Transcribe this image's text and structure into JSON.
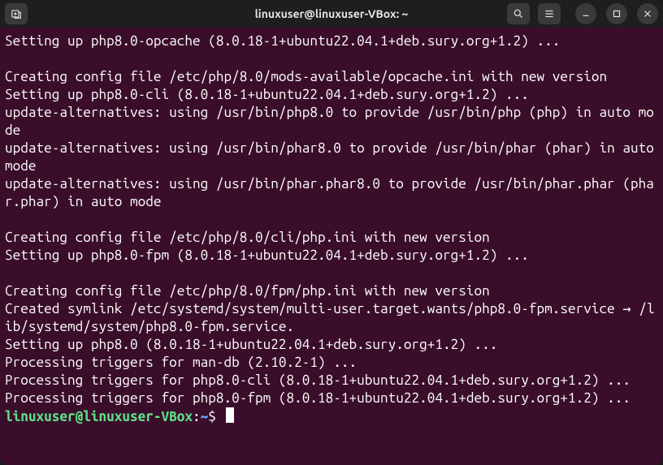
{
  "titlebar": {
    "title": "linuxuser@linuxuser-VBox: ~"
  },
  "icons": {
    "newtab": "new-tab-icon",
    "search": "search-icon",
    "menu": "hamburger-icon",
    "minimize": "minimize-icon",
    "maximize": "maximize-icon",
    "close": "close-icon"
  },
  "prompt": {
    "user": "linuxuser@linuxuser-VBox",
    "colon": ":",
    "path": "~",
    "dollar": "$ "
  },
  "output": "Setting up php8.0-opcache (8.0.18-1+ubuntu22.04.1+deb.sury.org+1.2) ...\n\nCreating config file /etc/php/8.0/mods-available/opcache.ini with new version\nSetting up php8.0-cli (8.0.18-1+ubuntu22.04.1+deb.sury.org+1.2) ...\nupdate-alternatives: using /usr/bin/php8.0 to provide /usr/bin/php (php) in auto mode\nupdate-alternatives: using /usr/bin/phar8.0 to provide /usr/bin/phar (phar) in auto mode\nupdate-alternatives: using /usr/bin/phar.phar8.0 to provide /usr/bin/phar.phar (phar.phar) in auto mode\n\nCreating config file /etc/php/8.0/cli/php.ini with new version\nSetting up php8.0-fpm (8.0.18-1+ubuntu22.04.1+deb.sury.org+1.2) ...\n\nCreating config file /etc/php/8.0/fpm/php.ini with new version\nCreated symlink /etc/systemd/system/multi-user.target.wants/php8.0-fpm.service → /lib/systemd/system/php8.0-fpm.service.\nSetting up php8.0 (8.0.18-1+ubuntu22.04.1+deb.sury.org+1.2) ...\nProcessing triggers for man-db (2.10.2-1) ...\nProcessing triggers for php8.0-cli (8.0.18-1+ubuntu22.04.1+deb.sury.org+1.2) ...\nProcessing triggers for php8.0-fpm (8.0.18-1+ubuntu22.04.1+deb.sury.org+1.2) ..."
}
